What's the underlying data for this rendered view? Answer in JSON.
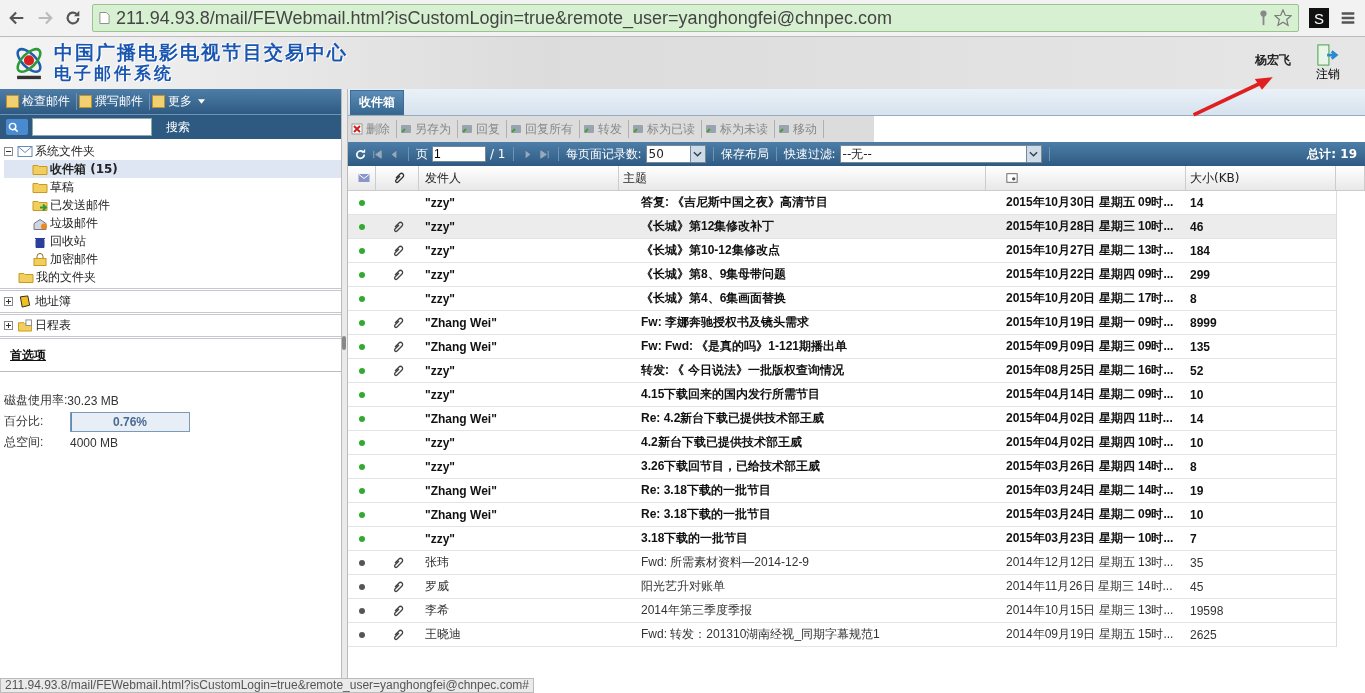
{
  "browser": {
    "url": "211.94.93.8/mail/FEWebmail.html?isCustomLogin=true&remote_user=yanghongfei@chnpec.com",
    "extension": "S"
  },
  "header": {
    "title": "中国广播电影电视节目交易中心",
    "subtitle": "电子邮件系统",
    "user": "杨宏飞",
    "logout": "注销"
  },
  "left_toolbar": [
    "检查邮件",
    "撰写邮件",
    "更多"
  ],
  "search": {
    "button": "搜索"
  },
  "tree": [
    {
      "label": "系统文件夹",
      "expanded": true,
      "selected": false,
      "children": [
        {
          "label": "收件箱 (15)",
          "selected": true
        },
        {
          "label": "草稿",
          "selected": false
        },
        {
          "label": "已发送邮件",
          "selected": false
        },
        {
          "label": "垃圾邮件",
          "selected": false
        },
        {
          "label": "回收站",
          "selected": false
        },
        {
          "label": "加密邮件",
          "selected": false
        }
      ]
    },
    {
      "label": "我的文件夹",
      "selected": false
    }
  ],
  "sections": [
    {
      "label": "地址簿",
      "expanded": false
    },
    {
      "label": "日程表",
      "expanded": false
    }
  ],
  "preferences": "首选项",
  "disk": {
    "usage_label": "磁盘使用率:",
    "usage": "30.23 MB",
    "percent_label": "百分比:",
    "percent": "0.76%",
    "level": 0.0076,
    "total_label": "总空间:",
    "total": "4000 MB"
  },
  "tabs": [
    {
      "label": "收件箱",
      "selected": true
    }
  ],
  "actions": [
    "删除",
    "另存为",
    "回复",
    "回复所有",
    "转发",
    "标为已读",
    "标为未读",
    "移动"
  ],
  "pager": {
    "page_label": "页",
    "page": "1",
    "of": "/ 1",
    "per_page_label": "每页面记录数:",
    "per_page": "50",
    "save_layout": "保存布局",
    "filter_label": "快速过滤:",
    "filter": "--无--",
    "total": "总计: 19"
  },
  "columns": [
    "发件人",
    "主题",
    "大小(KB)"
  ],
  "rows": [
    {
      "unread": true,
      "attachment": false,
      "selected": false,
      "sender": "\"zzy\"",
      "subject": "答复: 《吉尼斯中国之夜》高清节目",
      "date": "2015年10月30日 星期五 09时...",
      "size": "14"
    },
    {
      "unread": true,
      "attachment": true,
      "selected": true,
      "sender": "\"zzy\"",
      "subject": "《长城》第12集修改补丁",
      "date": "2015年10月28日 星期三 10时...",
      "size": "46"
    },
    {
      "unread": true,
      "attachment": true,
      "selected": false,
      "sender": "\"zzy\"",
      "subject": "《长城》第10-12集修改点",
      "date": "2015年10月27日 星期二 13时...",
      "size": "184"
    },
    {
      "unread": true,
      "attachment": true,
      "selected": false,
      "sender": "\"zzy\"",
      "subject": "《长城》第8、9集母带问题",
      "date": "2015年10月22日 星期四 09时...",
      "size": "299"
    },
    {
      "unread": true,
      "attachment": false,
      "selected": false,
      "sender": "\"zzy\"",
      "subject": "《长城》第4、6集画面替换",
      "date": "2015年10月20日 星期二 17时...",
      "size": "8"
    },
    {
      "unread": true,
      "attachment": true,
      "selected": false,
      "sender": "\"Zhang Wei\"",
      "subject": "Fw: 李娜奔驰授权书及镜头需求",
      "date": "2015年10月19日 星期一 09时...",
      "size": "8999"
    },
    {
      "unread": true,
      "attachment": true,
      "selected": false,
      "sender": "\"Zhang Wei\"",
      "subject": "Fw: Fwd: 《是真的吗》1-121期播出单",
      "date": "2015年09月09日 星期三 09时...",
      "size": "135"
    },
    {
      "unread": true,
      "attachment": true,
      "selected": false,
      "sender": "\"zzy\"",
      "subject": "转发: 《 今日说法》一批版权查询情况",
      "date": "2015年08月25日 星期二 16时...",
      "size": "52"
    },
    {
      "unread": true,
      "attachment": false,
      "selected": false,
      "sender": "\"zzy\"",
      "subject": "4.15下载回来的国内发行所需节目",
      "date": "2015年04月14日 星期二 09时...",
      "size": "10"
    },
    {
      "unread": true,
      "attachment": false,
      "selected": false,
      "sender": "\"Zhang Wei\"",
      "subject": "Re: 4.2新台下载已提供技术部王威",
      "date": "2015年04月02日 星期四 11时...",
      "size": "14"
    },
    {
      "unread": true,
      "attachment": false,
      "selected": false,
      "sender": "\"zzy\"",
      "subject": "4.2新台下载已提供技术部王威",
      "date": "2015年04月02日 星期四 10时...",
      "size": "10"
    },
    {
      "unread": true,
      "attachment": false,
      "selected": false,
      "sender": "\"zzy\"",
      "subject": "3.26下载回节目，已给技术部王威",
      "date": "2015年03月26日 星期四 14时...",
      "size": "8"
    },
    {
      "unread": true,
      "attachment": false,
      "selected": false,
      "sender": "\"Zhang Wei\"",
      "subject": "Re: 3.18下载的一批节目",
      "date": "2015年03月24日 星期二 14时...",
      "size": "19"
    },
    {
      "unread": true,
      "attachment": false,
      "selected": false,
      "sender": "\"Zhang Wei\"",
      "subject": "Re: 3.18下载的一批节目",
      "date": "2015年03月24日 星期二 09时...",
      "size": "10"
    },
    {
      "unread": true,
      "attachment": false,
      "selected": false,
      "sender": "\"zzy\"",
      "subject": "3.18下载的一批节目",
      "date": "2015年03月23日 星期一 10时...",
      "size": "7"
    },
    {
      "unread": false,
      "attachment": true,
      "selected": false,
      "sender": "张玮",
      "subject": "Fwd: 所需素材资料—2014-12-9",
      "date": "2014年12月12日 星期五 13时...",
      "size": "35"
    },
    {
      "unread": false,
      "attachment": true,
      "selected": false,
      "sender": "罗威",
      "subject": "阳光艺升对账单",
      "date": "2014年11月26日 星期三 14时...",
      "size": "45"
    },
    {
      "unread": false,
      "attachment": true,
      "selected": false,
      "sender": "李希",
      "subject": "2014年第三季度季报",
      "date": "2014年10月15日 星期三 13时...",
      "size": "19598"
    },
    {
      "unread": false,
      "attachment": true,
      "selected": false,
      "sender": "王晓迪",
      "subject": "Fwd: 转发：201310湖南经视_同期字幕规范1",
      "date": "2014年09月19日 星期五 15时...",
      "size": "2625"
    }
  ],
  "status_bar": "211.94.93.8/mail/FEWebmail.html?isCustomLogin=true&remote_user=yanghongfei@chnpec.com#"
}
